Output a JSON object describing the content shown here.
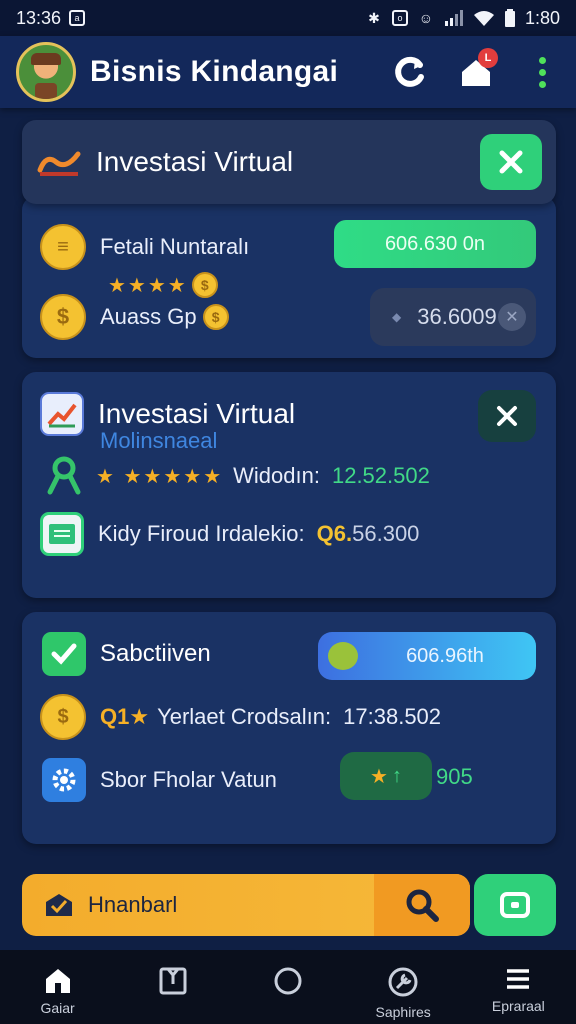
{
  "status_bar": {
    "time": "13:36",
    "clock": "1:80"
  },
  "header": {
    "title": "Bisnis Kindangai",
    "notif_badge": "L"
  },
  "card1": {
    "title": "Investasi Virtual",
    "row1_label": "Fetali Nuntaralı",
    "row1_value": "606.630 0n",
    "stars": "★★★★",
    "row2_label": "Auass Gp",
    "row2_value": "36.6009"
  },
  "card2": {
    "title": "Investasi Virtual",
    "subtitle": "Molinsnaeal",
    "stars": "★ ★★★★★",
    "row1_label": "Widodın:",
    "row1_value": "12.52.502",
    "row2_label": "Kidy Firoud Irdalekio:",
    "row2_value_prefix": "Q6.",
    "row2_value": "56.300"
  },
  "card3": {
    "title": "Sabctiiven",
    "pill_value": "606.96th",
    "row1_prefix": "Q1★",
    "row1_label": "Yerlaet Crodsalın:",
    "row1_value": "17:38.502",
    "row2_label": "Sbor Fholar Vatun",
    "row2_value": "905"
  },
  "search": {
    "label": "Hnanbarl"
  },
  "bottom_nav": [
    {
      "label": "Gaiar",
      "icon": "home-icon"
    },
    {
      "label": "",
      "icon": "bookmark-icon"
    },
    {
      "label": "",
      "icon": "circle-icon"
    },
    {
      "label": "Saphires",
      "icon": "wrench-icon"
    },
    {
      "label": "Epraraal",
      "icon": "menu-icon"
    }
  ],
  "colors": {
    "accent_green": "#2fd07a",
    "accent_orange": "#f3ac2c",
    "background": "#0f1f44"
  }
}
